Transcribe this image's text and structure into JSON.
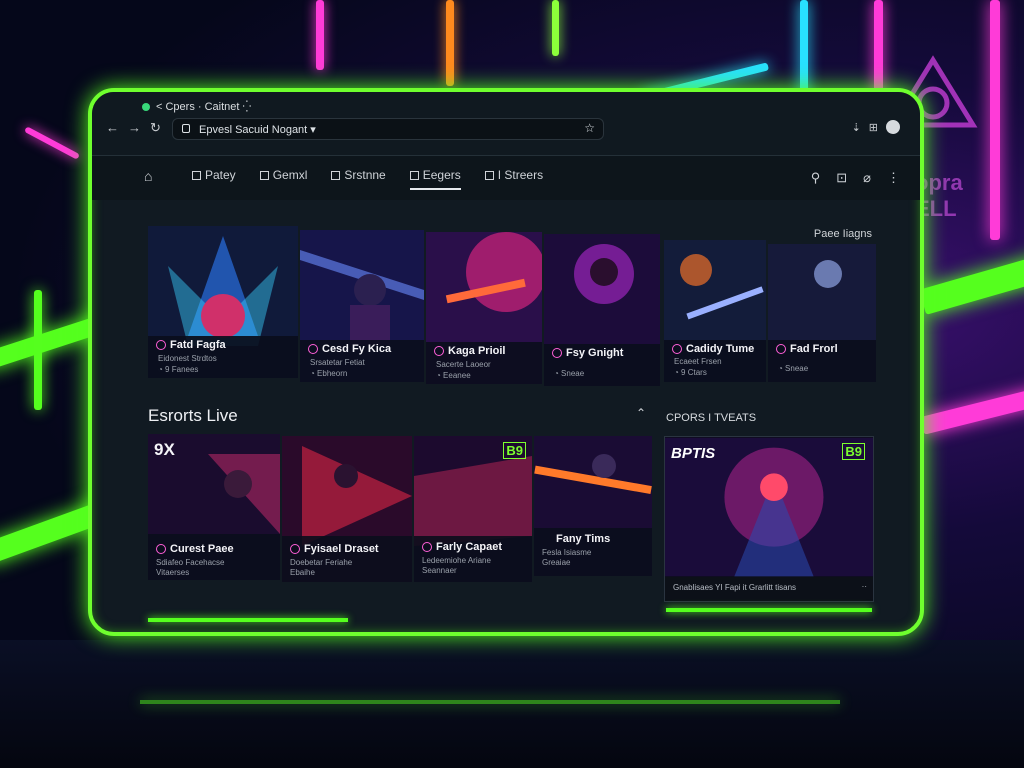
{
  "colors": {
    "neon_green": "#55ff1e",
    "neon_pink": "#ff3bd8",
    "neon_cyan": "#28e0ff",
    "panel": "#111a22"
  },
  "browser": {
    "tab_title": "< Cpers · Caitnet ⁛",
    "url": "Epvesl Sacuid Nogant ▾",
    "back_icon": "←",
    "forward_icon": "→",
    "reload_icon": "↻",
    "bookmark_icon": "☆",
    "tools": [
      "⇣",
      "⊞"
    ]
  },
  "nav": {
    "home_icon": "⌂",
    "tabs": [
      {
        "label": "Patey",
        "active": false
      },
      {
        "label": "Gemxl",
        "active": false
      },
      {
        "label": "Srstnne",
        "active": false
      },
      {
        "label": "Eegers",
        "active": true
      },
      {
        "label": "I Streers",
        "active": false
      }
    ],
    "right_icons": [
      "⚲",
      "⊡",
      "⌀",
      "⋮"
    ]
  },
  "featured": {
    "label": "Paee Iiagns",
    "cards": [
      {
        "title": "Fatd Fagfa",
        "sub": "Eidonest Strdtos",
        "meta": "◔ 9 Fanees"
      },
      {
        "title": "Cesd Fy Kica",
        "sub": "Srsatetar Fetiat",
        "meta": "◔ Ebheorn"
      },
      {
        "title": "Kaga Prioil",
        "sub": "Sacerte Laoeor",
        "meta": "◔ Eeanee"
      },
      {
        "title": "Fsy Gnight",
        "sub": "",
        "meta": "◔ Sneae"
      },
      {
        "title": "Cadidy Tume",
        "sub": "Ecaeet Frsen",
        "meta": "◔ 9 Ctars"
      },
      {
        "title": "Fad Frorl",
        "sub": "",
        "meta": "◔ Sneae"
      }
    ]
  },
  "esports": {
    "title": "Esrorts Live",
    "collapse_icon": "⌃",
    "cards": [
      {
        "title": "Curest Paee",
        "sub": "Sdiafeo Facehacse",
        "meta": "Vitaerses",
        "badge": "9X"
      },
      {
        "title": "Fyisael Draset",
        "sub": "Doebetar Feriahe",
        "meta": "Ebaihe",
        "badge": ""
      },
      {
        "title": "Farly Capaet",
        "sub": "Ledeemiohe Ariane",
        "meta": "Seannaer",
        "badge": "B9"
      },
      {
        "title": "Fany Tims",
        "sub": "Fesla Isiasme",
        "meta": "Greaiae",
        "badge": ""
      }
    ]
  },
  "sidebar": {
    "title": "CPORS I TVEATS",
    "brand": "BPTIS",
    "badge": "B9",
    "footer": "Gnablisaes  YI Fapi it Grarlitt tisans",
    "footer_icon": "··"
  },
  "background": {
    "logo_text": "opra\nELL"
  }
}
